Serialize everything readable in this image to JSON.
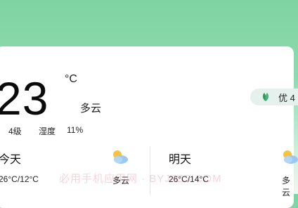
{
  "current": {
    "temperature": "23",
    "unit": "°C",
    "condition": "多云",
    "wind": "4级",
    "humidity_label": "湿度",
    "humidity_value": "11%"
  },
  "aqi": {
    "label": "优 4"
  },
  "forecast": [
    {
      "day": "今天",
      "range": "26°C/12°C",
      "condition": "多云",
      "icon": "partly-cloudy-icon"
    },
    {
      "day": "明天",
      "range": "26°C/14°C",
      "condition": "多云",
      "icon": "partly-cloudy-icon"
    }
  ],
  "watermark": "必用手机应用网 · BYJJZS.COM",
  "colors": {
    "header_green": "#7fd3a2",
    "aqi_leaf": "#2f9a64",
    "sun": "#f6c343",
    "cloud": "#9cc7ee"
  }
}
